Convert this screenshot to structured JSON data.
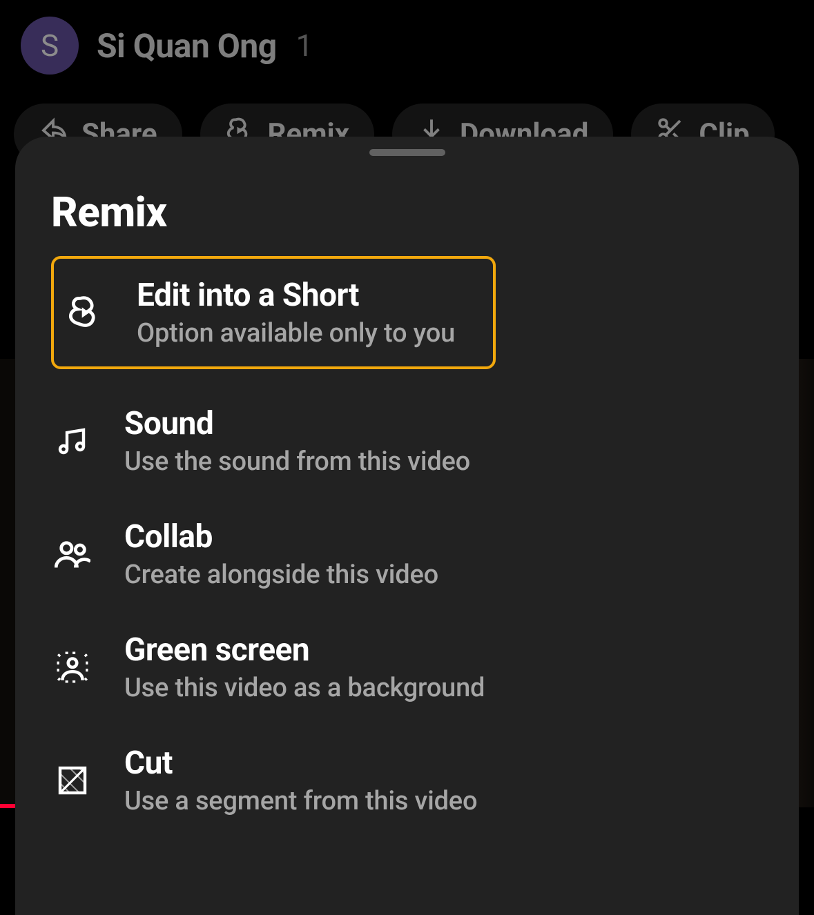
{
  "header": {
    "avatar_initial": "S",
    "channel_name": "Si Quan Ong",
    "count": "1"
  },
  "chips": {
    "share": "Share",
    "remix": "Remix",
    "download": "Download",
    "clip": "Clip"
  },
  "sheet": {
    "title": "Remix",
    "options": [
      {
        "icon": "shorts-icon",
        "title": "Edit into a Short",
        "subtitle": "Option available only to you",
        "highlighted": true
      },
      {
        "icon": "music-icon",
        "title": "Sound",
        "subtitle": "Use the sound from this video",
        "highlighted": false
      },
      {
        "icon": "people-icon",
        "title": "Collab",
        "subtitle": "Create alongside this video",
        "highlighted": false
      },
      {
        "icon": "green-screen-icon",
        "title": "Green screen",
        "subtitle": "Use this video as a background",
        "highlighted": false
      },
      {
        "icon": "cut-icon",
        "title": "Cut",
        "subtitle": "Use a segment from this video",
        "highlighted": false
      }
    ]
  }
}
